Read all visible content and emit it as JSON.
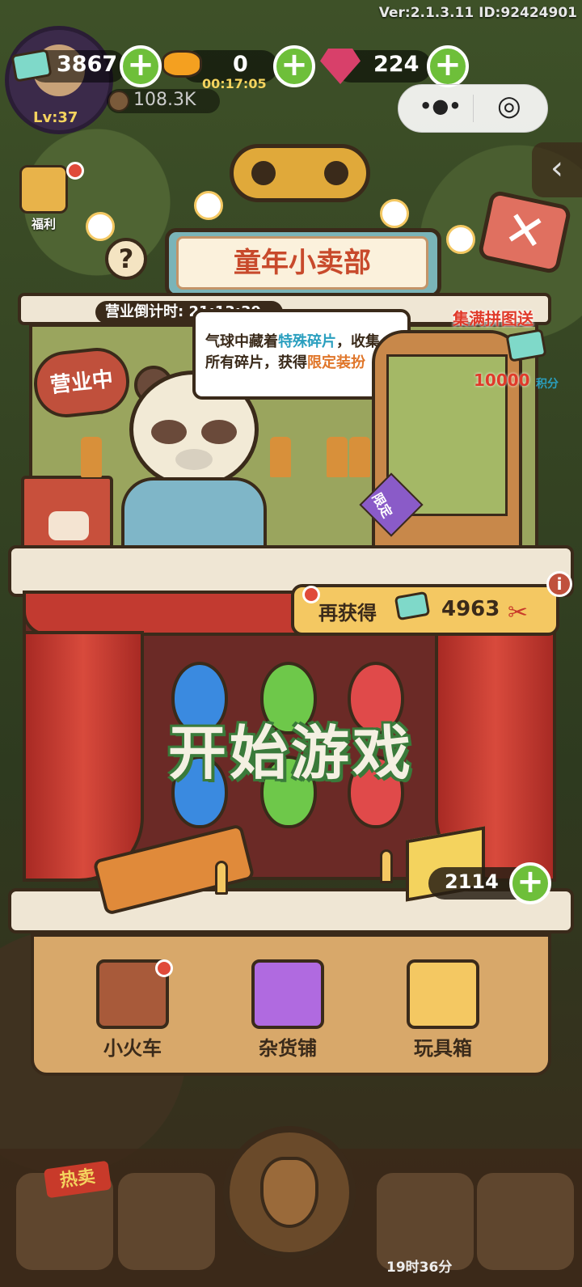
{
  "header": {
    "version": "Ver:2.1.3.11 ID:92424901",
    "level": "Lv:37",
    "acorns": "108.3K",
    "resources": [
      {
        "icon": "ticket-icon",
        "value": "3867"
      },
      {
        "icon": "candy-icon",
        "value": "0",
        "timer": "00:17:05"
      },
      {
        "icon": "gem-icon",
        "value": "224"
      }
    ],
    "capsule": {
      "more_icon": "•●•",
      "close_icon": "◎"
    }
  },
  "shop": {
    "title": "童年小卖部",
    "countdown": "营业倒计时: 21:13:39",
    "open_sign": "营业中",
    "bubble": {
      "line1_a": "气球中藏着",
      "line1_b": "特殊碎片",
      "line1_c": "，收集",
      "line2_a": "所有碎片，获得",
      "line2_b": "限定装扮"
    },
    "puzzle": {
      "tag": "集满拼图送",
      "points": "10000",
      "points_unit": "积分",
      "limited": "限定"
    }
  },
  "game": {
    "reward_label": "再获得",
    "reward_value": "4963",
    "start_label": "开始游戏",
    "ammo": "2114",
    "balloon_colors": [
      "#3a8ae0",
      "#6ec84a",
      "#e04a4a"
    ]
  },
  "base_menu": [
    {
      "label": "小火车",
      "icon": "train-cart-icon",
      "color": "#a85a3a"
    },
    {
      "label": "杂货铺",
      "icon": "shopping-bag-icon",
      "color": "#b06ae0"
    },
    {
      "label": "玩具箱",
      "icon": "toy-box-icon",
      "color": "#f4c862"
    }
  ],
  "nav": {
    "hot_label": "热卖",
    "tree_timer": "19时36分"
  },
  "side": {
    "welfare": "福利"
  },
  "colors": {
    "accent_green": "#6ebf3a",
    "title_red": "#c84a2c",
    "highlight_blue": "#2a9fbf",
    "highlight_orange": "#e0762a"
  }
}
